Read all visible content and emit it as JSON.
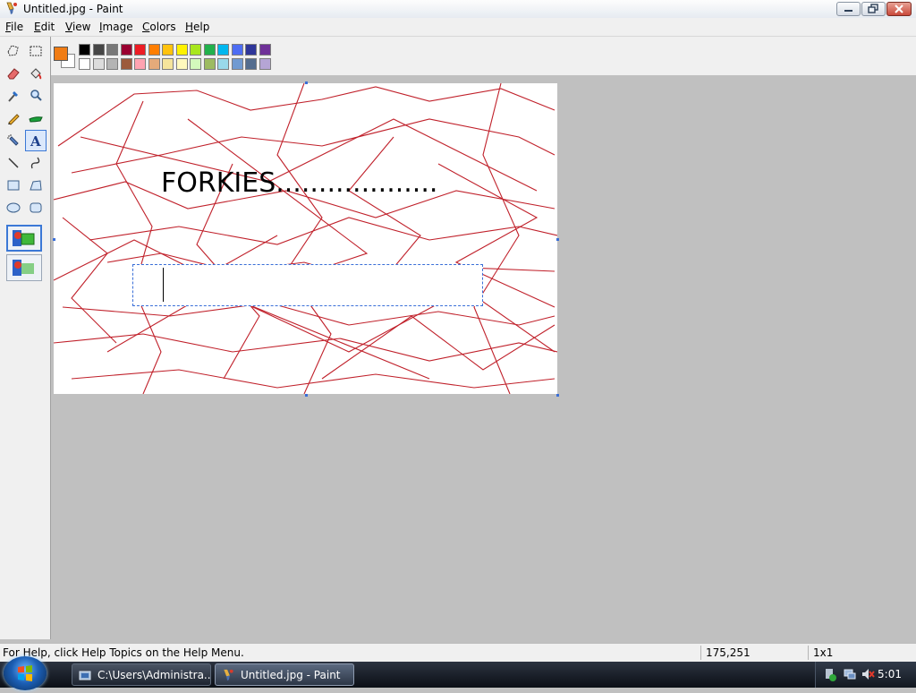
{
  "window": {
    "title": "Untitled.jpg - Paint"
  },
  "menu": [
    {
      "label": "File",
      "underline": "F",
      "rest": "ile"
    },
    {
      "label": "Edit",
      "underline": "E",
      "rest": "dit"
    },
    {
      "label": "View",
      "underline": "V",
      "rest": "iew"
    },
    {
      "label": "Image",
      "underline": "I",
      "rest": "mage"
    },
    {
      "label": "Colors",
      "underline": "C",
      "rest": "olors"
    },
    {
      "label": "Help",
      "underline": "H",
      "rest": "elp"
    }
  ],
  "tools": [
    {
      "name": "free-form-select-icon"
    },
    {
      "name": "rect-select-icon"
    },
    {
      "name": "eraser-icon"
    },
    {
      "name": "fill-bucket-icon"
    },
    {
      "name": "color-picker-icon"
    },
    {
      "name": "magnifier-icon"
    },
    {
      "name": "pencil-icon"
    },
    {
      "name": "brush-icon"
    },
    {
      "name": "airbrush-icon"
    },
    {
      "name": "text-tool-icon",
      "active": true
    },
    {
      "name": "line-icon"
    },
    {
      "name": "curve-icon"
    },
    {
      "name": "rectangle-icon"
    },
    {
      "name": "polygon-icon"
    },
    {
      "name": "ellipse-icon"
    },
    {
      "name": "rounded-rect-icon"
    }
  ],
  "text_tool_options": [
    {
      "name": "opaque-background-option",
      "active": true
    },
    {
      "name": "transparent-background-option",
      "active": false
    }
  ],
  "colors": {
    "foreground": "#f07c14",
    "background": "#ffffff",
    "palette_top": [
      "#000000",
      "#464646",
      "#787878",
      "#990030",
      "#ed1c24",
      "#ff7e00",
      "#ffc20e",
      "#fff200",
      "#a8e61d",
      "#22b14c",
      "#00b7ef",
      "#4d6df3",
      "#2f3699",
      "#6f3198"
    ],
    "palette_bottom": [
      "#ffffff",
      "#dcdcdc",
      "#b4b4b4",
      "#9c5a3c",
      "#ffa3b1",
      "#e5aa7a",
      "#f5e49c",
      "#fff9bd",
      "#d3f9bc",
      "#9dbb61",
      "#99d9ea",
      "#709ad1",
      "#546d8e",
      "#b5a5d5"
    ]
  },
  "canvas": {
    "text": "FORKIES...................",
    "text_color": "#000000",
    "scribble_color": "#c0202a"
  },
  "status": {
    "help": "For Help, click Help Topics on the Help Menu.",
    "coords": "175,251",
    "size": "1x1"
  },
  "taskbar": {
    "buttons": [
      {
        "label": "C:\\Users\\Administra...",
        "active": false
      },
      {
        "label": "Untitled.jpg - Paint",
        "active": true
      }
    ],
    "clock": "5:01"
  }
}
